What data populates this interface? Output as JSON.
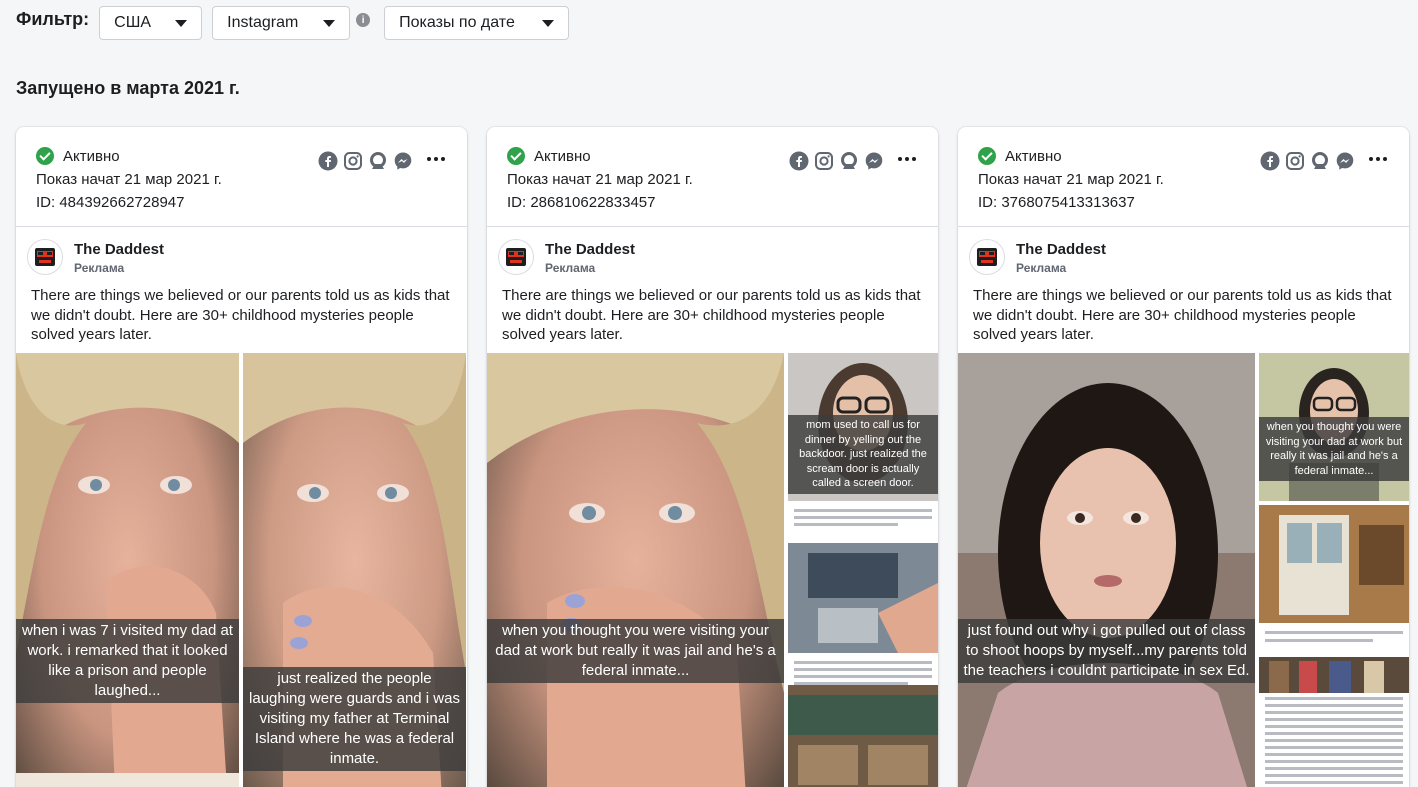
{
  "filter": {
    "label": "Фильтр:",
    "country": "США",
    "platform": "Instagram",
    "info": "i",
    "sort": "Показы по дате"
  },
  "section_title": "Запущено в марта 2021 г.",
  "cards": [
    {
      "status": "Активно",
      "started": "Показ начат 21 мар 2021 г.",
      "id": "ID: 484392662728947",
      "advertiser": "The Daddest",
      "sponsored": "Реклама",
      "text": "There are things we believed or our parents told us as kids that we didn't doubt. Here are 30+ childhood mysteries people solved years later.",
      "captions": [
        "when i was 7 i visited my dad at work. i remarked that it looked like a prison and people laughed...",
        "just realized the people laughing were guards and i was visiting my father at Terminal Island where he was a federal inmate."
      ]
    },
    {
      "status": "Активно",
      "started": "Показ начат 21 мар 2021 г.",
      "id": "ID: 286810622833457",
      "advertiser": "The Daddest",
      "sponsored": "Реклама",
      "text": "There are things we believed or our parents told us as kids that we didn't doubt. Here are 30+ childhood mysteries people solved years later.",
      "captions": [
        "when you thought you were visiting your dad at work but really it was jail and he's a federal inmate...",
        "mom used to call us for dinner by yelling out the backdoor. just realized the scream door is actually called a screen door."
      ]
    },
    {
      "status": "Активно",
      "started": "Показ начат 21 мар 2021 г.",
      "id": "ID: 3768075413313637",
      "advertiser": "The Daddest",
      "sponsored": "Реклама",
      "text": "There are things we believed or our parents told us as kids that we didn't doubt. Here are 30+ childhood mysteries people solved years later.",
      "captions": [
        "just found out why i got pulled out of class to shoot hoops by myself...my parents told the teachers i couldnt participate in sex Ed.",
        "when you thought you were visiting your dad at work but really it was jail and he's a federal inmate..."
      ]
    }
  ],
  "colors": {
    "active_green": "#31a24c",
    "border": "#dadde1",
    "text": "#1c1e21",
    "muted": "#606770"
  }
}
